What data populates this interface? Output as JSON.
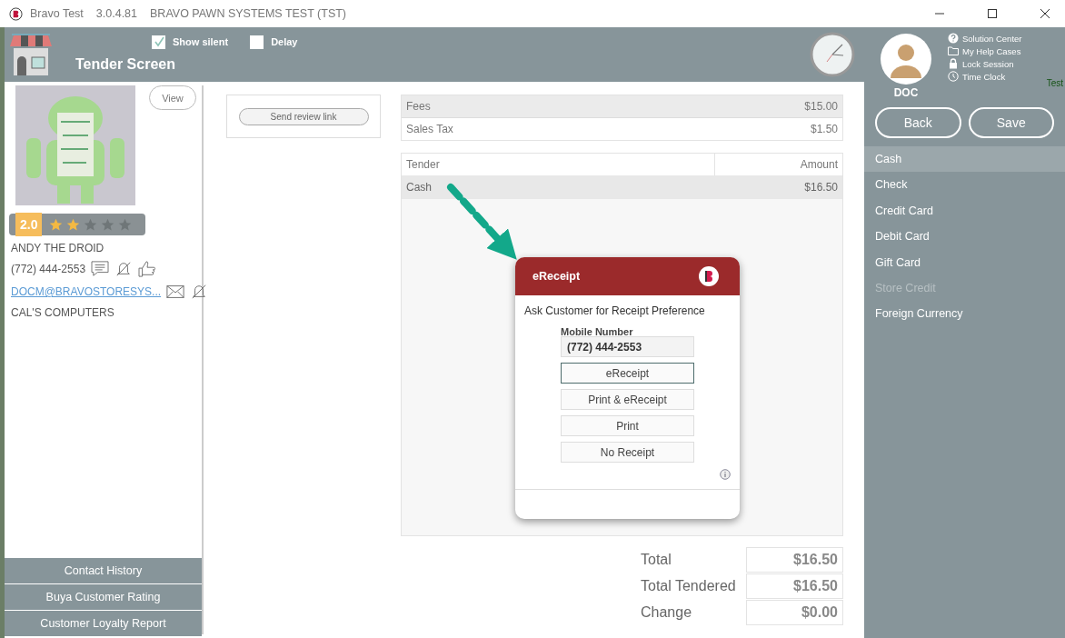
{
  "window": {
    "app": "Bravo Test",
    "version": "3.0.4.81",
    "title": "BRAVO PAWN SYSTEMS TEST (TST)"
  },
  "header": {
    "title": "Tender Screen",
    "options": [
      {
        "label": "Show silent",
        "checked": true
      },
      {
        "label": "Delay",
        "checked": false
      }
    ]
  },
  "customer": {
    "view_button": "View",
    "rating": "2.0",
    "stars": 2,
    "name": "ANDY THE DROID",
    "phone": "(772) 444-2553",
    "email": "DOCM@BRAVOSTORESYS...",
    "company": "CAL'S COMPUTERS"
  },
  "left_buttons": [
    "Contact History",
    "Buya Customer Rating",
    "Customer Loyalty Report"
  ],
  "review_button": "Send review link",
  "fees": [
    {
      "label": "Fees",
      "amount": "$15.00"
    },
    {
      "label": "Sales Tax",
      "amount": "$1.50"
    }
  ],
  "tender_table": {
    "columns": [
      "Tender",
      "Amount"
    ],
    "rows": [
      {
        "tender": "Cash",
        "amount": "$16.50",
        "selected": true
      }
    ]
  },
  "totals": [
    {
      "label": "Total",
      "value": "$16.50"
    },
    {
      "label": "Total Tendered",
      "value": "$16.50"
    },
    {
      "label": "Change",
      "value": "$0.00"
    }
  ],
  "user": {
    "name": "DOC",
    "links": [
      "Solution Center",
      "My Help Cases",
      "Lock Session",
      "Time Clock"
    ],
    "badge": "Test"
  },
  "actions": [
    "Back",
    "Save"
  ],
  "tender_methods": [
    {
      "label": "Cash",
      "selected": true,
      "disabled": false
    },
    {
      "label": "Check",
      "selected": false,
      "disabled": false
    },
    {
      "label": "Credit Card",
      "selected": false,
      "disabled": false
    },
    {
      "label": "Debit Card",
      "selected": false,
      "disabled": false
    },
    {
      "label": "Gift Card",
      "selected": false,
      "disabled": false
    },
    {
      "label": "Store Credit",
      "selected": false,
      "disabled": true
    },
    {
      "label": "Foreign Currency",
      "selected": false,
      "disabled": false
    }
  ],
  "dialog": {
    "title": "eReceipt",
    "prompt": "Ask Customer for Receipt Preference",
    "field_label": "Mobile Number",
    "field_value": "(772) 444-2553",
    "options": [
      {
        "label": "eReceipt",
        "selected": true
      },
      {
        "label": "Print & eReceipt",
        "selected": false
      },
      {
        "label": "Print",
        "selected": false
      },
      {
        "label": "No Receipt",
        "selected": false
      }
    ]
  }
}
